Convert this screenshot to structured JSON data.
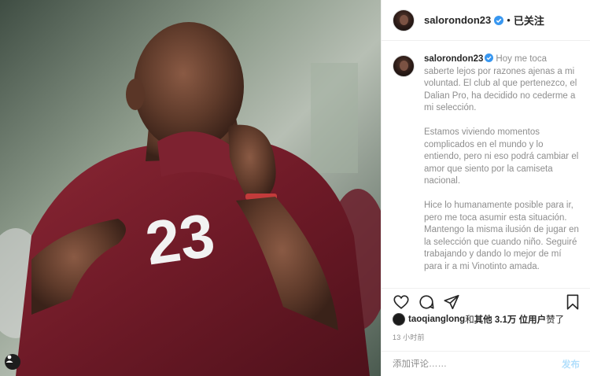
{
  "post": {
    "image_alt": "Player in maroon number 23 jersey kissing the shirt",
    "jersey_number": "23"
  },
  "header": {
    "username": "salorondon23",
    "dot": "•",
    "follow_status": "已关注"
  },
  "caption": {
    "username": "salorondon23",
    "paragraphs": [
      "Hoy me toca saberte lejos por razones ajenas a mi voluntad. El club al que pertenezco, el Dalian Pro, ha decidido no cederme a mi selección.",
      "Estamos viviendo momentos complicados en el mundo y lo entiendo, pero ni eso podrá cambiar el amor que siento por la camiseta nacional.",
      "Hice lo humanamente posible para ir, pero me toca asumir esta situación. Mantengo la misma ilusión de jugar en la selección que cuando niño. Seguiré trabajando y dando lo mejor de mí para ir a mi Vinotinto amada."
    ]
  },
  "likes": {
    "liker": "taoqianglong",
    "connector": " 和 ",
    "others": "其他 3.1万 位用户",
    "suffix": " 赞了"
  },
  "timestamp": "13 小时前",
  "comment_box": {
    "placeholder": "添加评论……",
    "post_label": "发布"
  },
  "colors": {
    "verified_blue": "#3897f0",
    "jersey": "#7a1f2b",
    "post_button_disabled": "#b2dffc"
  },
  "icons": [
    "heart-icon",
    "comment-icon",
    "share-icon",
    "bookmark-icon",
    "verified-icon",
    "user-tag-icon"
  ]
}
